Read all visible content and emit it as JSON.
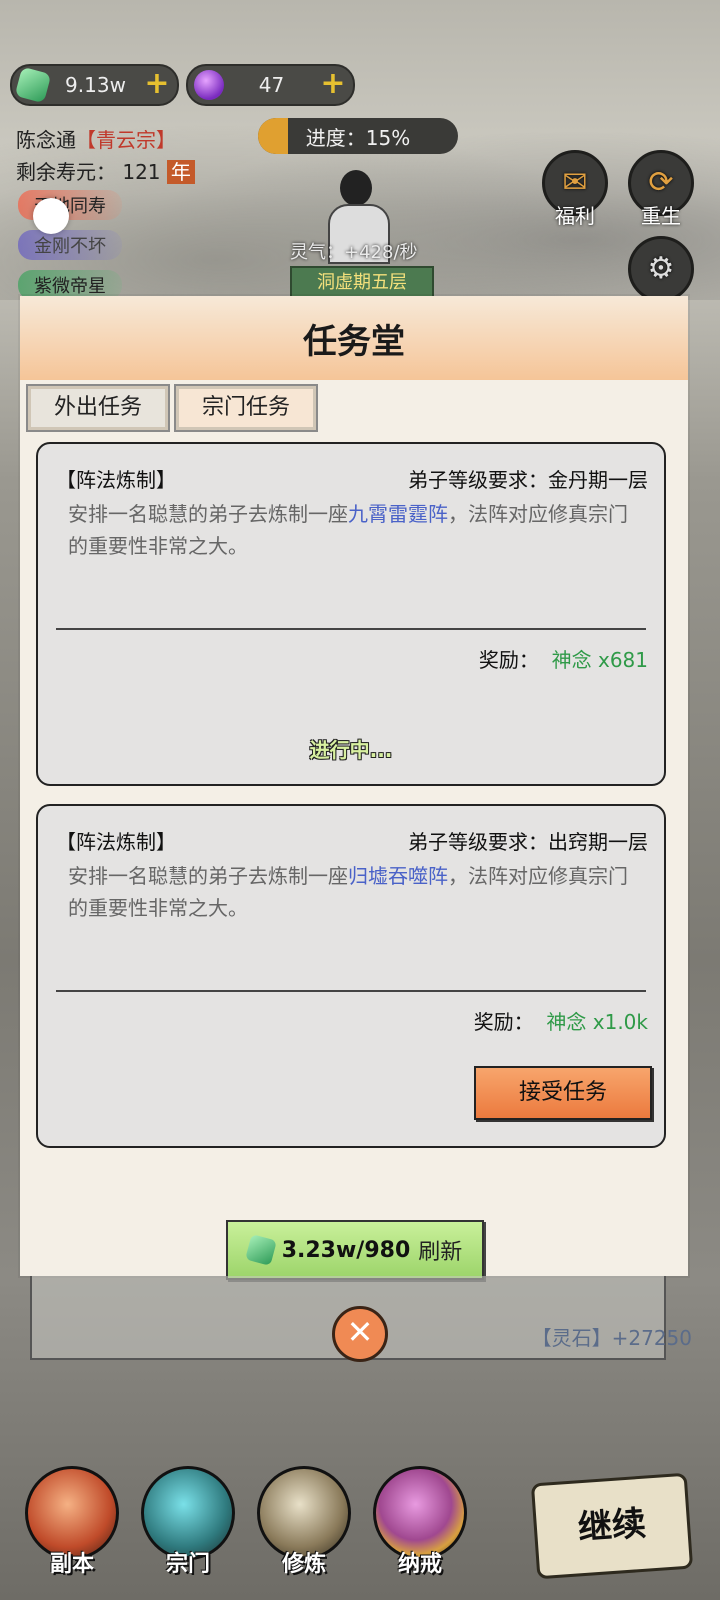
{
  "resources": {
    "stones": "9.13w",
    "gems": "47",
    "add_symbol": "+"
  },
  "player": {
    "name": "陈念通",
    "sect": "【青云宗】",
    "life_label": "剩余寿元：",
    "life_value": "121",
    "life_unit": "年",
    "buffs": [
      "天地同寿",
      "金刚不坏",
      "紫微帝星"
    ]
  },
  "progress": {
    "label": "进度：15%",
    "fraction": 0.15
  },
  "character": {
    "lingqi": "灵气：+428/秒",
    "realm": "洞虚期五层"
  },
  "side_buttons": {
    "welfare": "福利",
    "reborn": "重生",
    "settings": "设置"
  },
  "modal": {
    "title": "任务堂",
    "tabs": [
      "外出任务",
      "宗门任务"
    ],
    "tasks": [
      {
        "title": "【阵法炼制】",
        "req": "弟子等级要求：金丹期一层",
        "desc_pre": "安排一名聪慧的弟子去炼制一座",
        "desc_hl": "九霄雷霆阵",
        "desc_post": "，法阵对应修真宗门的重要性非常之大。",
        "reward_label": "奖励：",
        "reward_value": "神念 x681",
        "status": "进行中..."
      },
      {
        "title": "【阵法炼制】",
        "req": "弟子等级要求：出窍期一层",
        "desc_pre": "安排一名聪慧的弟子去炼制一座",
        "desc_hl": "归墟吞噬阵",
        "desc_post": "，法阵对应修真宗门的重要性非常之大。",
        "reward_label": "奖励：",
        "reward_value": "神念 x1.0k",
        "button": "接受任务"
      }
    ],
    "refresh_cost": "3.23w/980",
    "refresh_label": "刷新"
  },
  "log": {
    "text": "【灵石】+27250"
  },
  "close_symbol": "✕",
  "bottom_nav": [
    "副本",
    "宗门",
    "修炼",
    "纳戒"
  ],
  "continue_label": "继续"
}
